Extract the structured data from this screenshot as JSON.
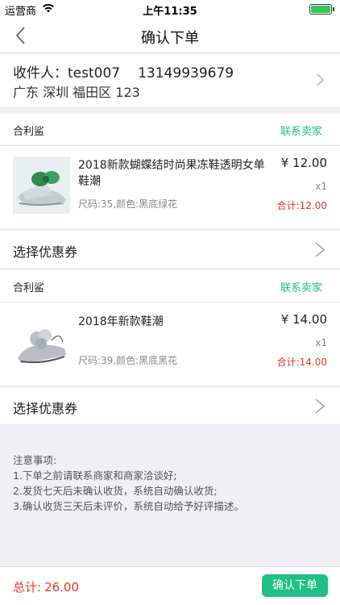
{
  "status_bar": {
    "carrier": "运营商",
    "time": "上午11:35"
  },
  "nav": {
    "title": "确认下单"
  },
  "address": {
    "recipient_label": "收件人：",
    "recipient_name": "test007",
    "phone": "13149939679",
    "detail": "广东 深圳 福田区 123"
  },
  "shops": [
    {
      "name": "合利鲨",
      "contact_label": "联系卖家",
      "item": {
        "name": "2018新款蝴蝶结时尚果冻鞋透明女单鞋潮",
        "spec": "尺码:35,颜色:黑底绿花",
        "price": "¥ 12.00",
        "qty": "x1",
        "subtotal": "合计:12.00"
      },
      "coupon_label": "选择优惠券"
    },
    {
      "name": "合利鲨",
      "contact_label": "联系卖家",
      "item": {
        "name": "2018年新款鞋潮",
        "spec": "尺码:39,颜色:黑底黑花",
        "price": "¥ 14.00",
        "qty": "x1",
        "subtotal": "合计:14.00"
      },
      "coupon_label": "选择优惠券"
    }
  ],
  "notes": {
    "title": "注意事项:",
    "lines": [
      "1.下单之前请联系商家和商家洽谈好;",
      "2.发货七天后未确认收货，系统自动确认收货;",
      "3.确认收货三天后未评价，系统自动给予好评描述。"
    ]
  },
  "footer": {
    "total_label": "总计:",
    "total_amount": "26.00",
    "submit_label": "确认下单"
  },
  "colors": {
    "accent": "#1fbf86",
    "price_red": "#e8381d",
    "background": "#efeff4"
  }
}
